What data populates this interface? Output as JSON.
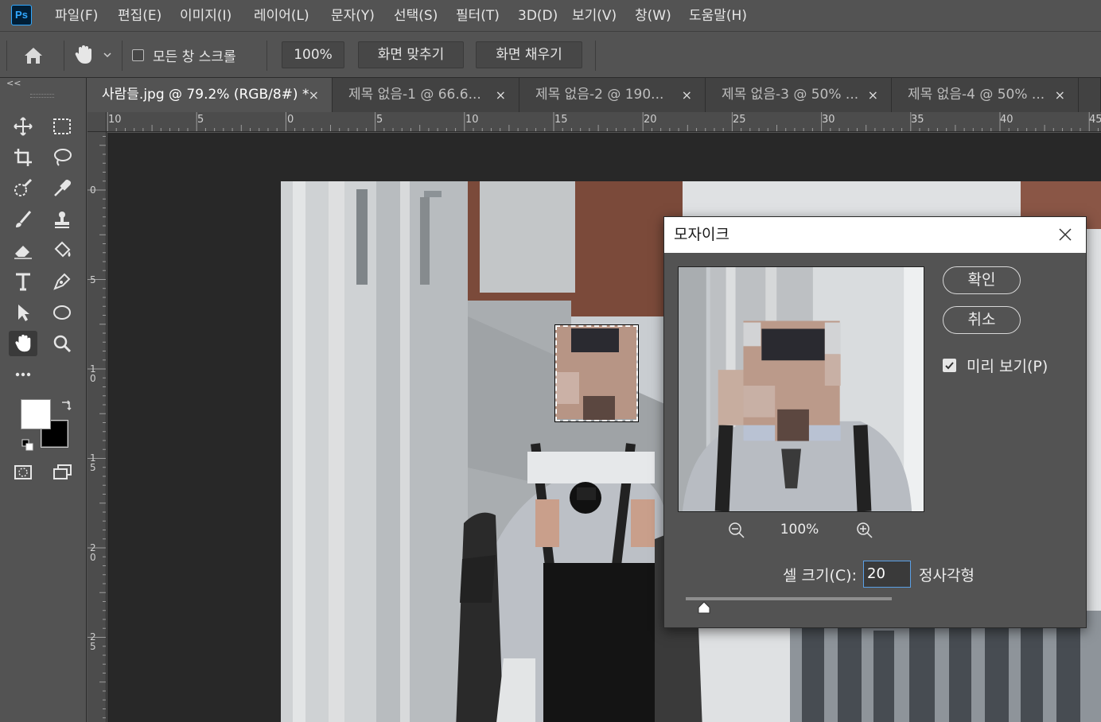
{
  "app": {
    "logo": "Ps"
  },
  "menu": [
    "파일(F)",
    "편집(E)",
    "이미지(I)",
    "레이어(L)",
    "문자(Y)",
    "선택(S)",
    "필터(T)",
    "3D(D)",
    "보기(V)",
    "창(W)",
    "도움말(H)"
  ],
  "options": {
    "scroll_all_label": "모든 창 스크롤",
    "zoom_value": "100%",
    "fit_screen_label": "화면 맞추기",
    "fill_screen_label": "화면 채우기"
  },
  "panel_collapse": "<<",
  "tabs": [
    {
      "label": "사람들.jpg @ 79.2% (RGB/8#) *",
      "active": true
    },
    {
      "label": "제목 없음-1 @ 66.6...",
      "active": false
    },
    {
      "label": "제목 없음-2 @ 190...",
      "active": false
    },
    {
      "label": "제목 없음-3 @ 50% ...",
      "active": false
    },
    {
      "label": "제목 없음-4 @ 50% ...",
      "active": false
    }
  ],
  "tab_close_glyph": "×",
  "ruler_h": [
    "10",
    "5",
    "0",
    "5",
    "10",
    "15",
    "20",
    "25",
    "30",
    "35",
    "40",
    "45"
  ],
  "ruler_v": [
    "0",
    "5",
    "10",
    "15",
    "20",
    "25"
  ],
  "tools": [
    "move-icon",
    "marquee-icon",
    "crop-icon",
    "lasso-icon",
    "quick-select-icon",
    "eyedropper-icon",
    "brush-icon",
    "stamp-icon",
    "eraser-icon",
    "paint-bucket-icon",
    "type-icon",
    "pen-icon",
    "path-select-icon",
    "ellipse-icon",
    "hand-icon",
    "zoom-icon",
    "more-icon"
  ],
  "colors": {
    "foreground": "#ffffff",
    "background": "#000000",
    "accent": "#31a8ff"
  },
  "dialog": {
    "title": "모자이크",
    "ok_label": "확인",
    "cancel_label": "취소",
    "preview_label": "미리 보기(P)",
    "preview_checked": true,
    "zoom_level": "100%",
    "cell_size_label": "셀 크기(C):",
    "cell_size_value": "20",
    "cell_size_unit": "정사각형",
    "slider_fraction": 0.04
  }
}
